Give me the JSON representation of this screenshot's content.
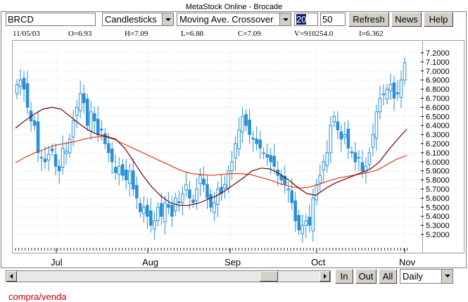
{
  "window_title": "MetaStock Online - Brocade",
  "symbol": "BRCD",
  "chart_style": "Candlesticks",
  "indicator": "Moving Ave. Crossover",
  "ma_short": "20",
  "ma_long": "50",
  "buttons": {
    "refresh": "Refresh",
    "news": "News",
    "help": "Help",
    "in": "In",
    "out": "Out",
    "all": "All"
  },
  "period": "Daily",
  "quote": {
    "date": "11/05/03",
    "open": "O=6.93",
    "high": "H=7.09",
    "low": "L=6.88",
    "close": "C=7.09",
    "volume": "V=910254.0",
    "indicator": "I=6.362"
  },
  "bottom_text": "compra/venda",
  "colors": {
    "candle": "#2b8fd8",
    "ma_short": "#6b0000",
    "ma_long": "#e23a1a",
    "grid": "#cfd8e8"
  },
  "chart_data": {
    "type": "candlestick",
    "y_ticks": [
      "7.2000",
      "7.1000",
      "7.0000",
      "6.9000",
      "6.8000",
      "6.7000",
      "6.6000",
      "6.5000",
      "6.4000",
      "6.3000",
      "6.2000",
      "6.1000",
      "6.0000",
      "5.9000",
      "5.8000",
      "5.7000",
      "5.6000",
      "5.5000",
      "5.4000",
      "5.3000",
      "5.2000"
    ],
    "ylim": [
      5.2,
      7.2
    ],
    "x_ticks": [
      "Jul",
      "Aug",
      "Sep",
      "Oct",
      "Nov"
    ],
    "series": [
      {
        "name": "Close",
        "values": [
          6.85,
          6.9,
          6.8,
          6.6,
          6.45,
          6.4,
          6.1,
          6.05,
          6.0,
          6.08,
          6.12,
          5.95,
          5.9,
          6.15,
          6.12,
          6.25,
          6.45,
          6.6,
          6.75,
          6.65,
          6.4,
          6.55,
          6.45,
          6.3,
          6.35,
          6.2,
          6.1,
          6.0,
          5.88,
          5.95,
          5.85,
          5.8,
          5.9,
          5.7,
          5.6,
          5.45,
          5.5,
          5.4,
          5.3,
          5.35,
          5.5,
          5.4,
          5.55,
          5.5,
          5.4,
          5.6,
          5.55,
          5.65,
          5.75,
          5.6,
          5.55,
          5.7,
          5.85,
          5.75,
          5.6,
          5.5,
          5.55,
          5.7,
          5.65,
          5.75,
          5.9,
          6.0,
          6.2,
          6.35,
          6.5,
          6.4,
          6.3,
          6.25,
          6.2,
          6.15,
          6.1,
          6.05,
          6.0,
          5.95,
          5.85,
          5.8,
          5.75,
          5.7,
          5.55,
          5.35,
          5.25,
          5.3,
          5.35,
          5.3,
          5.6,
          5.75,
          5.85,
          6.0,
          6.1,
          6.4,
          6.5,
          6.35,
          6.25,
          6.3,
          6.15,
          6.1,
          6.0,
          6.05,
          5.9,
          5.95,
          6.1,
          6.3,
          6.55,
          6.7,
          6.75,
          6.8,
          6.85,
          6.7,
          6.75,
          6.9,
          7.09
        ]
      },
      {
        "name": "MA 20",
        "values": [
          6.37,
          6.45,
          6.52,
          6.58,
          6.6,
          6.58,
          6.5,
          6.42,
          6.35,
          6.3,
          6.28,
          6.25,
          6.15,
          6.0,
          5.85,
          5.72,
          5.62,
          5.55,
          5.52,
          5.52,
          5.54,
          5.58,
          5.62,
          5.68,
          5.75,
          5.82,
          5.9,
          5.93,
          5.92,
          5.87,
          5.8,
          5.72,
          5.65,
          5.63,
          5.7,
          5.76,
          5.8,
          5.84,
          5.88,
          5.92,
          6.0,
          6.13,
          6.25,
          6.36
        ]
      },
      {
        "name": "MA 50",
        "values": [
          5.99,
          6.05,
          6.1,
          6.14,
          6.18,
          6.2,
          6.22,
          6.25,
          6.27,
          6.28,
          6.25,
          6.2,
          6.15,
          6.1,
          6.05,
          6.0,
          5.95,
          5.9,
          5.87,
          5.86,
          5.85,
          5.86,
          5.87,
          5.87,
          5.86,
          5.83,
          5.8,
          5.76,
          5.73,
          5.71,
          5.72,
          5.75,
          5.79,
          5.82,
          5.84,
          5.86,
          5.88,
          5.91,
          5.97,
          6.03,
          6.07
        ]
      }
    ]
  }
}
